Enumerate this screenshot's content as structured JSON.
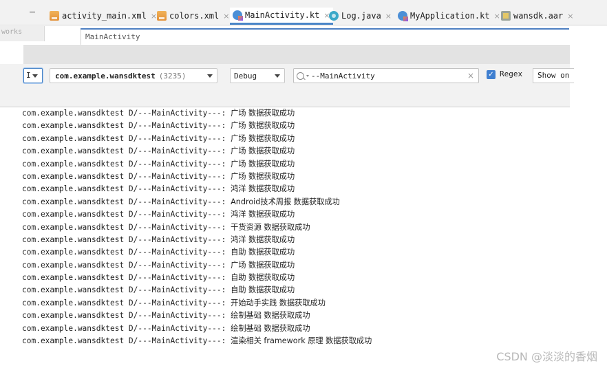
{
  "tabbar": {
    "collapse_symbol": "—",
    "tabs": [
      {
        "label": "activity_main.xml",
        "icon": "xml-file-icon"
      },
      {
        "label": "colors.xml",
        "icon": "xml-file-icon"
      },
      {
        "label": "MainActivity.kt",
        "icon": "kotlin-class-icon",
        "active": true
      },
      {
        "label": "Log.java",
        "icon": "java-class-icon"
      },
      {
        "label": "MyApplication.kt",
        "icon": "kotlin-class-icon"
      },
      {
        "label": "wansdk.aar",
        "icon": "archive-icon"
      }
    ],
    "close_symbol": "×"
  },
  "breadcrumb": {
    "side_panel_label": "works",
    "text": "MainActivity"
  },
  "logcat_toolbar": {
    "device_fragment": "I",
    "package": "com.example.wansdktest",
    "pid": "(3235)",
    "log_level": "Debug",
    "search_value": "--MainActivity",
    "clear_symbol": "×",
    "regex_checked": true,
    "regex_label": "Regex",
    "filter_dropdown": "Show on"
  },
  "log": {
    "prefix": "com.example.wansdktest D/---MainActivity---:",
    "lines": [
      "广场 数据获取成功",
      "广场 数据获取成功",
      "广场 数据获取成功",
      "广场 数据获取成功",
      "广场 数据获取成功",
      "广场 数据获取成功",
      "鸿洋 数据获取成功",
      "Android技术周报 数据获取成功",
      "鸿洋 数据获取成功",
      "干货资源 数据获取成功",
      "鸿洋 数据获取成功",
      "自助 数据获取成功",
      "广场 数据获取成功",
      "自助 数据获取成功",
      "自助 数据获取成功",
      "开始动手实践 数据获取成功",
      "绘制基础 数据获取成功",
      "绘制基础 数据获取成功",
      "渲染相关 framework 原理 数据获取成功"
    ]
  },
  "watermark": "CSDN @淡淡的香烟",
  "colors": {
    "active_tab_underline": "#4a86c8",
    "checkbox_blue": "#3f7fd0"
  }
}
